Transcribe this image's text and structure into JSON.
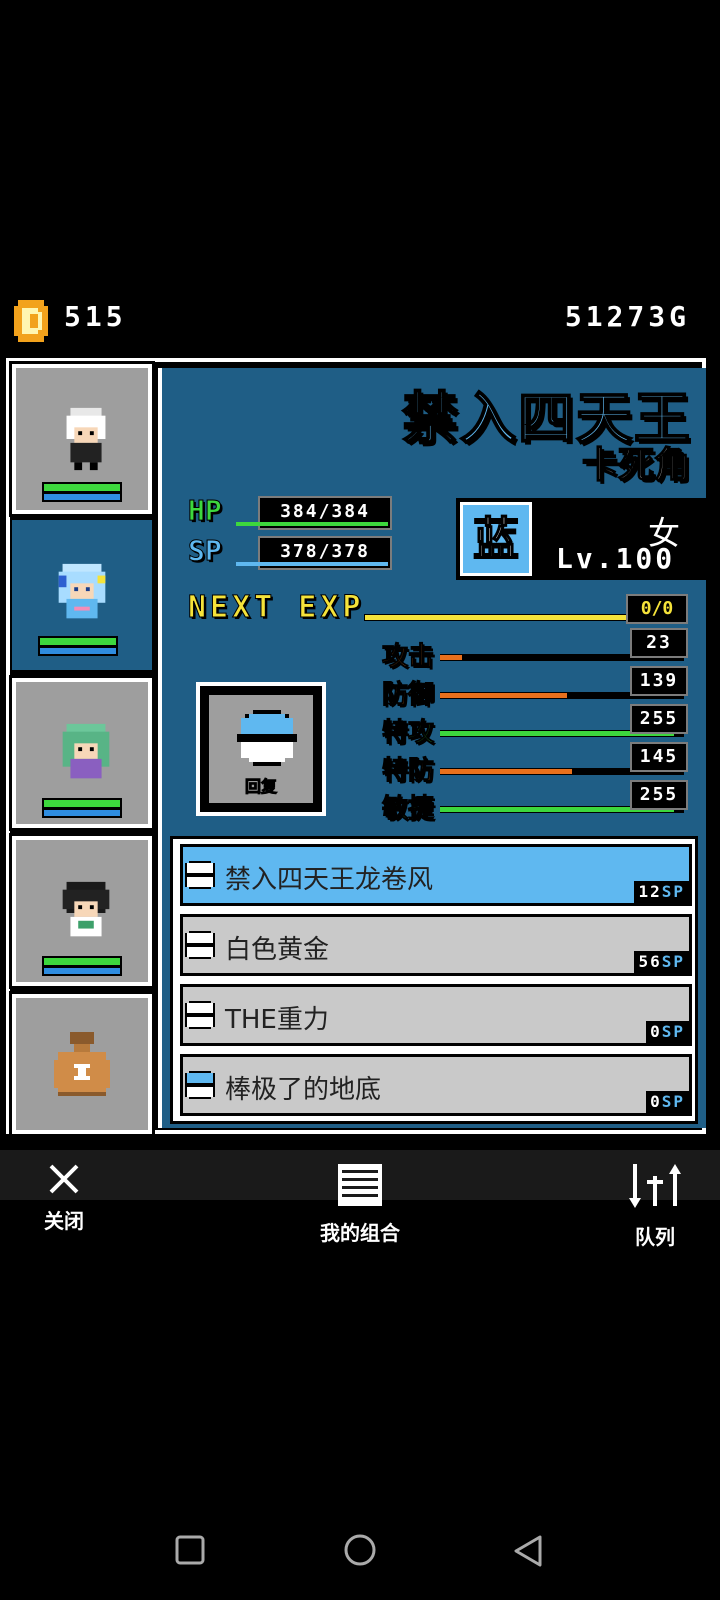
{
  "currency": {
    "icon": "gem-coin-icon",
    "count": "515",
    "gold": "51273G"
  },
  "character": {
    "name": "禁入四天王",
    "subname": "卡死角",
    "element": "蓝",
    "gender": "女",
    "level": "Lv.100",
    "hp": {
      "label": "HP",
      "value": "384/384",
      "fraction": 1.0
    },
    "sp": {
      "label": "SP",
      "value": "378/378",
      "fraction": 1.0
    },
    "next_exp": {
      "label": "NEXT EXP",
      "value": "0/0"
    },
    "stats": [
      {
        "label": "攻击",
        "value": "23",
        "fraction": 0.09,
        "color": "#e8701c",
        "label_color": "#f07c1c"
      },
      {
        "label": "防御",
        "value": "139",
        "fraction": 0.52,
        "color": "#e8701c",
        "label_color": "#f07c1c"
      },
      {
        "label": "特攻",
        "value": "255",
        "fraction": 0.96,
        "color": "#3dd83d",
        "label_color": "#3dd83d"
      },
      {
        "label": "特防",
        "value": "145",
        "fraction": 0.54,
        "color": "#e8701c",
        "label_color": "#f07c1c"
      },
      {
        "label": "敏捷",
        "value": "255",
        "fraction": 0.96,
        "color": "#3dd83d",
        "label_color": "#3dd83d"
      }
    ]
  },
  "heal_button": {
    "label": "回复"
  },
  "skills": [
    {
      "name": "禁入四天王龙卷风",
      "cost": "12",
      "unit": "SP",
      "selected": true
    },
    {
      "name": "白色黄金",
      "cost": "56",
      "unit": "SP",
      "selected": false
    },
    {
      "name": "THE重力",
      "cost": "0",
      "unit": "SP",
      "selected": false
    },
    {
      "name": "棒极了的地底",
      "cost": "0",
      "unit": "SP",
      "selected": false
    }
  ],
  "toolbar": {
    "close": "关闭",
    "my_team": "我的组合",
    "queue": "队列"
  },
  "colors": {
    "panel_blue": "#1f5e86",
    "accent_blue": "#5fb8f0",
    "exp_yellow": "#f5e33a",
    "hp_green": "#3dd83d"
  }
}
